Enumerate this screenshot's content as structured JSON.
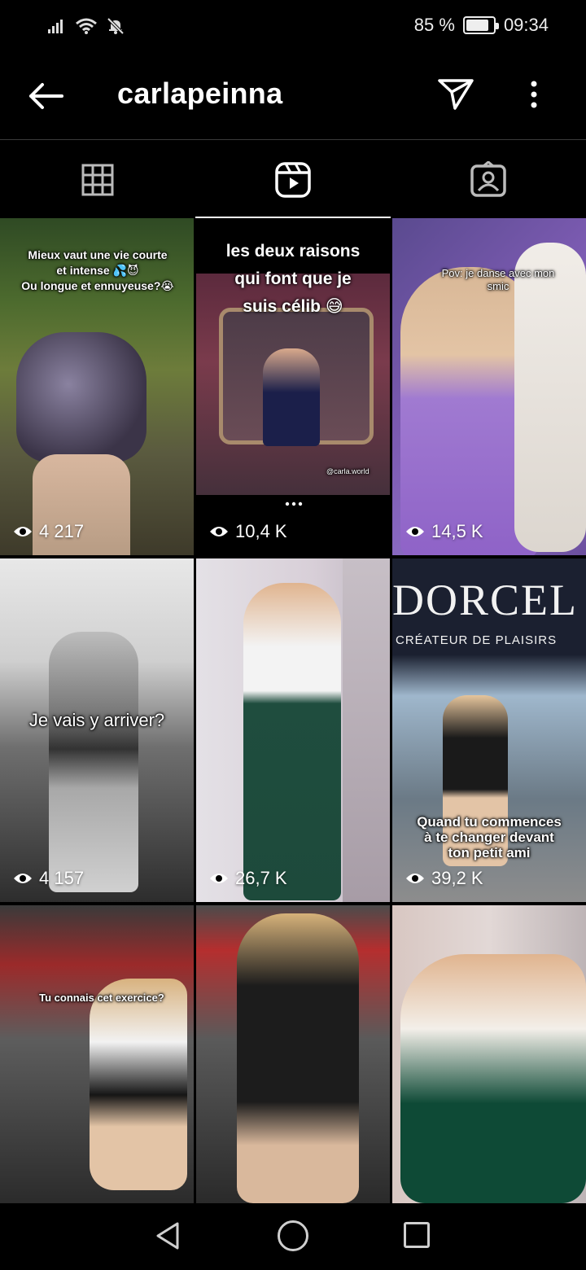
{
  "status_bar": {
    "battery": "85 %",
    "battery_level": 0.85,
    "time": "09:34",
    "icons": [
      "signal-icon",
      "wifi-icon",
      "bell-off-icon",
      "battery-icon"
    ]
  },
  "header": {
    "username": "carlapeinna",
    "icons": [
      "back-arrow-icon",
      "send-icon",
      "more-vertical-icon"
    ]
  },
  "tabs": [
    {
      "name": "grid",
      "icon": "grid-icon",
      "active": false
    },
    {
      "name": "reels",
      "icon": "reels-icon",
      "active": true
    },
    {
      "name": "tagged",
      "icon": "tagged-icon",
      "active": false
    }
  ],
  "reels": [
    {
      "views": "4 217",
      "overlay": "Mieux vaut une vie courte\net intense 💦😈\nOu longue et ennuyeuse?😭"
    },
    {
      "views": "10,4 K",
      "overlay": "les deux raisons\nqui font que je\nsuis célib 😅",
      "watermark": "@carla.world"
    },
    {
      "views": "14,5 K",
      "overlay": "Pov: je danse avec mon\nsmic"
    },
    {
      "views": "4 157",
      "overlay": "Je vais y arriver?"
    },
    {
      "views": "26,7 K",
      "overlay": ""
    },
    {
      "views": "39,2 K",
      "overlay": "Quand tu commences\nà te changer devant\nton petit ami",
      "sign_main": "DORCEL",
      "sign_sub": "CRÉATEUR DE PLAISIRS"
    },
    {
      "views": "",
      "overlay": "Tu connais cet exercice?"
    },
    {
      "views": "",
      "overlay": ""
    },
    {
      "views": "",
      "overlay": ""
    }
  ],
  "nav": {
    "icons": [
      "nav-back-icon",
      "nav-home-icon",
      "nav-recents-icon"
    ]
  }
}
